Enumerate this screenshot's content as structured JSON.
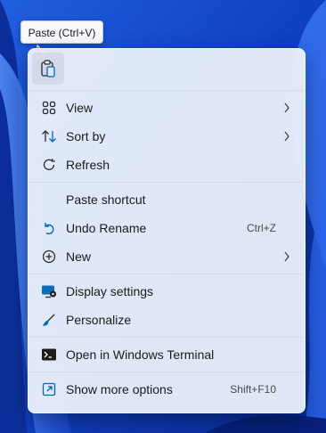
{
  "tooltip": {
    "text": "Paste (Ctrl+V)"
  },
  "menu": {
    "toolbar": {
      "paste_icon": "paste-icon"
    },
    "group1": [
      {
        "label": "View",
        "icon": "grid-icon",
        "submenu": true
      },
      {
        "label": "Sort by",
        "icon": "sort-icon",
        "submenu": true
      },
      {
        "label": "Refresh",
        "icon": "refresh-icon",
        "submenu": false
      }
    ],
    "group2": [
      {
        "label": "Paste shortcut",
        "icon": "",
        "submenu": false
      },
      {
        "label": "Undo Rename",
        "icon": "undo-icon",
        "shortcut": "Ctrl+Z"
      },
      {
        "label": "New",
        "icon": "new-icon",
        "submenu": true
      }
    ],
    "group3": [
      {
        "label": "Display settings",
        "icon": "display-icon"
      },
      {
        "label": "Personalize",
        "icon": "brush-icon"
      }
    ],
    "group4": [
      {
        "label": "Open in Windows Terminal",
        "icon": "terminal-icon"
      }
    ],
    "group5": [
      {
        "label": "Show more options",
        "icon": "more-options-icon",
        "shortcut": "Shift+F10"
      }
    ]
  },
  "colors": {
    "accent": "#0067c0",
    "wallpaper": "#1a56d6"
  }
}
